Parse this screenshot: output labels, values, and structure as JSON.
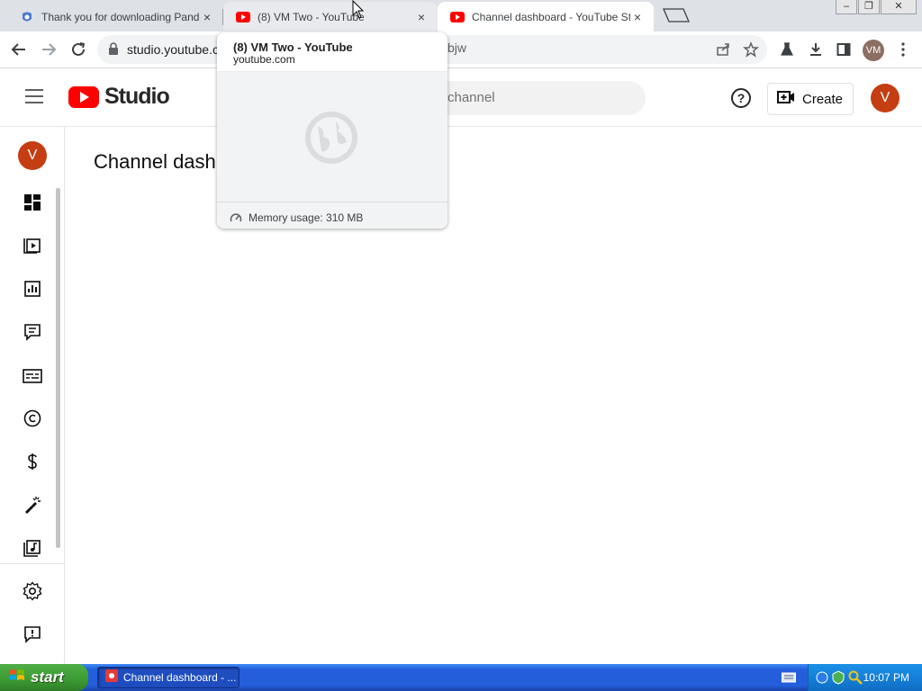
{
  "browser": {
    "tabs": [
      {
        "title": "Thank you for downloading Panda S",
        "favicon": "panda-favicon",
        "close": "×"
      },
      {
        "title": "(8) VM Two - YouTube",
        "favicon": "youtube-favicon",
        "close": "×"
      },
      {
        "title": "Channel dashboard - YouTube Studi",
        "favicon": "youtube-favicon",
        "close": "×"
      }
    ],
    "window_controls": {
      "minimize": "–",
      "maximize": "❐",
      "close": "✕"
    },
    "url": "studio.youtube.c",
    "url_tail": "bjw",
    "profile_initials": "VM"
  },
  "hovercard": {
    "title": "(8) VM Two - YouTube",
    "domain": "youtube.com",
    "memory": "Memory usage: 310 MB"
  },
  "studio": {
    "logo_text": "Studio",
    "search_placeholder": "channel",
    "create_label": "Create",
    "avatar_initial": "V",
    "page_title": "Channel dashboard",
    "nav_items": [
      "dashboard-icon",
      "content-icon",
      "analytics-icon",
      "comments-icon",
      "subtitles-icon",
      "copyright-icon",
      "earn-icon",
      "customization-icon",
      "audio-library-icon",
      "settings-icon",
      "feedback-icon"
    ]
  },
  "taskbar": {
    "start_label": "start",
    "task_label": "Channel dashboard - ...",
    "clock": "10:07 PM"
  },
  "colors": {
    "youtube_red": "#ff0000",
    "avatar": "#c53d12",
    "xp_blue": "#245edb",
    "xp_green": "#3c9a33"
  }
}
